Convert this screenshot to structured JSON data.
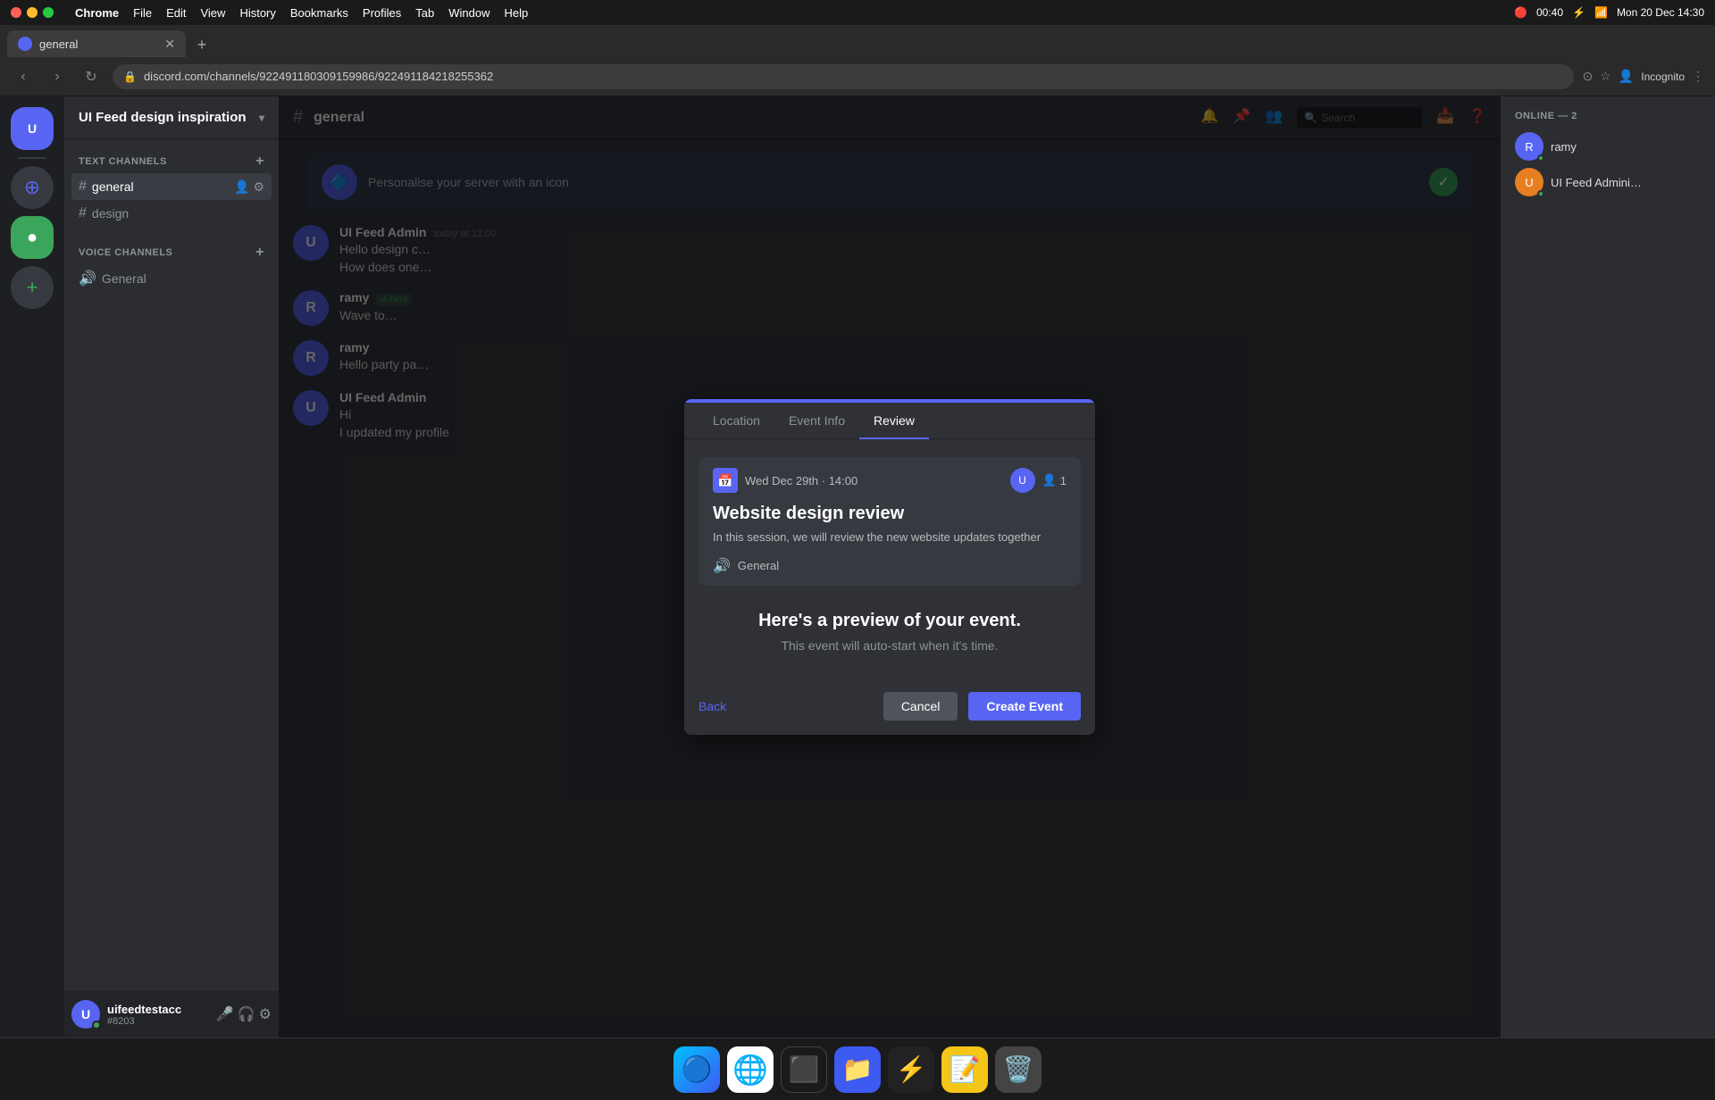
{
  "macos": {
    "menubar": {
      "appName": "Chrome",
      "items": [
        "File",
        "Edit",
        "View",
        "History",
        "Bookmarks",
        "Profiles",
        "Tab",
        "Window",
        "Help"
      ],
      "time": "Mon 20 Dec  14:30",
      "battery": "00:40"
    }
  },
  "browser": {
    "tab": {
      "title": "general",
      "url": "discord.com/channels/922491180309159986/922491184218255362"
    },
    "toolbar": {
      "back": "‹",
      "forward": "›",
      "refresh": "↻",
      "search_placeholder": "Search"
    }
  },
  "discord": {
    "server": {
      "name": "UI Feed design inspiration"
    },
    "channel": {
      "current": "general"
    },
    "channels": {
      "text_section": "TEXT CHANNELS",
      "voice_section": "VOICE CHANNELS",
      "text_channels": [
        {
          "name": "general",
          "active": true
        },
        {
          "name": "design",
          "active": false
        }
      ],
      "voice_channels": [
        {
          "name": "General",
          "active": false
        }
      ]
    },
    "online_users": [
      {
        "name": "ramy",
        "initials": "R"
      },
      {
        "name": "UI Feed Admini…",
        "initials": "U"
      }
    ],
    "messages": [
      {
        "author": "UI Feed Admin",
        "time": "today at 12:00",
        "lines": [
          "Hello design c…",
          "How does one…"
        ],
        "initials": "U",
        "avatarColor": "#5865f2"
      },
      {
        "author": "ramy",
        "time": "is here",
        "lines": [
          "Wave to…"
        ],
        "initials": "R",
        "avatarColor": "#5865f2"
      },
      {
        "author": "ramy",
        "time": "",
        "lines": [
          "Hello party pa…"
        ],
        "initials": "R",
        "avatarColor": "#5865f2"
      },
      {
        "author": "UI Feed Admin",
        "time": "",
        "lines": [
          "Hi",
          "I updated my profile"
        ],
        "initials": "U",
        "avatarColor": "#5865f2"
      }
    ],
    "boost_banner": {
      "text": "Personalise your server with an icon"
    },
    "user": {
      "name": "uifeedtestacc",
      "tag": "#8203",
      "initials": "U"
    }
  },
  "modal": {
    "tabs": [
      {
        "label": "Location",
        "state": "done"
      },
      {
        "label": "Event Info",
        "state": "done"
      },
      {
        "label": "Review",
        "state": "active"
      }
    ],
    "event": {
      "date": "Wed Dec 29th · 14:00",
      "title": "Website design review",
      "description": "In this session, we will review the new website updates together",
      "location": "General",
      "attendee_count": "1"
    },
    "preview": {
      "title": "Here's a preview of your event.",
      "subtitle": "This event will auto-start when it's time."
    },
    "buttons": {
      "back": "Back",
      "cancel": "Cancel",
      "create": "Create Event"
    }
  },
  "dock": {
    "icons": [
      "🔵",
      "🌐",
      "⬛",
      "📁",
      "⚡",
      "📝",
      "🗑️"
    ]
  }
}
